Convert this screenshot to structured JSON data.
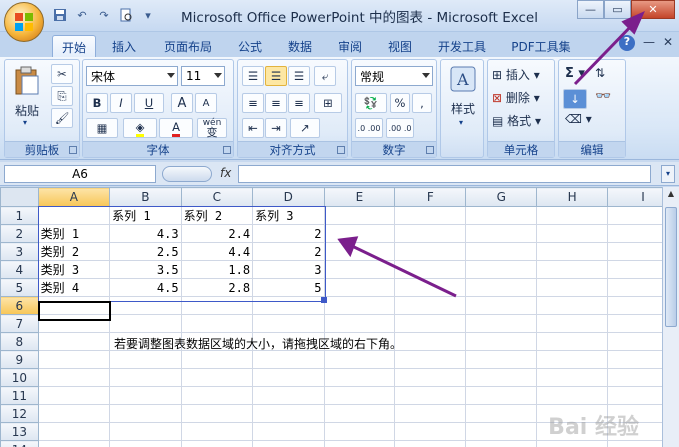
{
  "window": {
    "title": "Microsoft Office PowerPoint 中的图表 - Microsoft Excel",
    "minimize": "—",
    "restore": "▭",
    "close": "✕"
  },
  "qat": [
    "save-icon",
    "undo-icon",
    "redo-icon",
    "preview-icon",
    "customize-icon"
  ],
  "tabs": [
    "开始",
    "插入",
    "页面布局",
    "公式",
    "数据",
    "审阅",
    "视图",
    "开发工具",
    "PDF工具集"
  ],
  "tab_right": {
    "help": "?",
    "min": "—",
    "close": "✕"
  },
  "ribbon": {
    "clipboard": {
      "label": "剪贴板",
      "paste": "粘贴"
    },
    "font": {
      "label": "字体",
      "name": "宋体",
      "size": "11",
      "bold": "B",
      "italic": "I",
      "underline": "U",
      "grow": "A",
      "shrink": "A",
      "wen": "wén",
      "wen_char": "变"
    },
    "alignment": {
      "label": "对齐方式"
    },
    "number": {
      "label": "数字",
      "format": "常规",
      "percent": "%",
      "comma": ",",
      "inc": ".0 .00",
      "dec": ".00 .0"
    },
    "styles": {
      "label": "样式"
    },
    "cells": {
      "label": "单元格",
      "insert": "插入",
      "delete": "删除",
      "format": "格式"
    },
    "editing": {
      "label": "编辑",
      "sigma": "Σ"
    }
  },
  "formula_bar": {
    "name_box": "A6",
    "fx": "fx",
    "value": ""
  },
  "columns": [
    "A",
    "B",
    "C",
    "D",
    "E",
    "F",
    "G",
    "H",
    "I"
  ],
  "rows": [
    "1",
    "2",
    "3",
    "4",
    "5",
    "6",
    "7",
    "8",
    "9",
    "10",
    "11",
    "12",
    "13",
    "14"
  ],
  "cells": {
    "header": [
      "",
      "系列 1",
      "系列 2",
      "系列 3"
    ],
    "data": [
      [
        "类别 1",
        "4.3",
        "2.4",
        "2"
      ],
      [
        "类别 2",
        "2.5",
        "4.4",
        "2"
      ],
      [
        "类别 3",
        "3.5",
        "1.8",
        "3"
      ],
      [
        "类别 4",
        "4.5",
        "2.8",
        "5"
      ]
    ],
    "note": "若要调整图表数据区域的大小，请拖拽区域的右下角。"
  },
  "colors": {
    "arrow": "#7b1f8c",
    "range_border": "#3e59c8"
  },
  "watermark": "Bai 经验"
}
